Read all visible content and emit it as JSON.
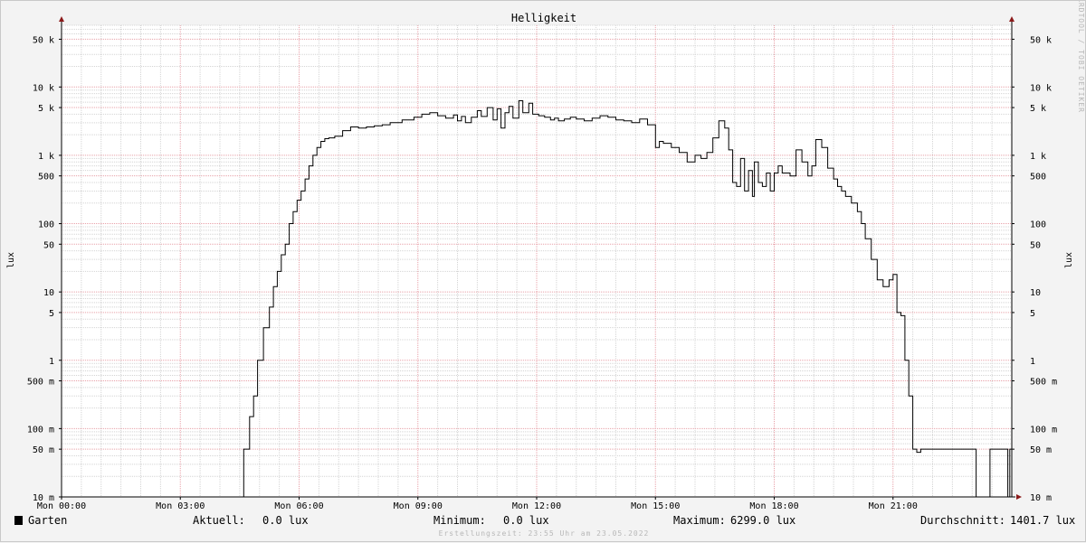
{
  "chart_data": {
    "type": "line",
    "title": "Helligkeit",
    "ylabel": "lux",
    "ylabel_right": "lux",
    "yscale": "log",
    "ylim": [
      0.01,
      80000
    ],
    "xlim": [
      0,
      24
    ],
    "watermark": "RRDTOOL / TOBI OETIKER",
    "grid": true,
    "x_ticks": [
      {
        "value": 0,
        "label": "Mon 00:00"
      },
      {
        "value": 3,
        "label": "Mon 03:00"
      },
      {
        "value": 6,
        "label": "Mon 06:00"
      },
      {
        "value": 9,
        "label": "Mon 09:00"
      },
      {
        "value": 12,
        "label": "Mon 12:00"
      },
      {
        "value": 15,
        "label": "Mon 15:00"
      },
      {
        "value": 18,
        "label": "Mon 18:00"
      },
      {
        "value": 21,
        "label": "Mon 21:00"
      }
    ],
    "y_ticks": [
      {
        "value": 0.01,
        "label": "10 m"
      },
      {
        "value": 0.05,
        "label": "50 m"
      },
      {
        "value": 0.1,
        "label": "100 m"
      },
      {
        "value": 0.5,
        "label": "500 m"
      },
      {
        "value": 1,
        "label": "1"
      },
      {
        "value": 5,
        "label": "5"
      },
      {
        "value": 10,
        "label": "10"
      },
      {
        "value": 50,
        "label": "50"
      },
      {
        "value": 100,
        "label": "100"
      },
      {
        "value": 500,
        "label": "500"
      },
      {
        "value": 1000,
        "label": "1 k"
      },
      {
        "value": 5000,
        "label": "5 k"
      },
      {
        "value": 10000,
        "label": "10 k"
      },
      {
        "value": 50000,
        "label": "50 k"
      }
    ],
    "series": [
      {
        "name": "Garten",
        "color": "#000000",
        "x": [
          0,
          4.6,
          4.6,
          4.75,
          4.85,
          4.95,
          5.1,
          5.25,
          5.35,
          5.45,
          5.55,
          5.65,
          5.75,
          5.85,
          5.95,
          6.05,
          6.15,
          6.25,
          6.35,
          6.45,
          6.55,
          6.65,
          6.75,
          6.9,
          7.1,
          7.3,
          7.5,
          7.7,
          7.9,
          8.1,
          8.3,
          8.6,
          8.9,
          9.1,
          9.3,
          9.5,
          9.7,
          9.9,
          10.0,
          10.1,
          10.2,
          10.35,
          10.5,
          10.6,
          10.75,
          10.9,
          11.0,
          11.1,
          11.2,
          11.3,
          11.4,
          11.55,
          11.65,
          11.8,
          11.9,
          12.05,
          12.2,
          12.35,
          12.45,
          12.55,
          12.7,
          12.85,
          13.0,
          13.2,
          13.4,
          13.6,
          13.8,
          14.0,
          14.2,
          14.4,
          14.6,
          14.8,
          15.0,
          15.1,
          15.2,
          15.4,
          15.6,
          15.8,
          16.0,
          16.15,
          16.3,
          16.45,
          16.6,
          16.75,
          16.85,
          16.95,
          17.05,
          17.15,
          17.25,
          17.35,
          17.45,
          17.5,
          17.6,
          17.7,
          17.8,
          17.9,
          18.0,
          18.1,
          18.2,
          18.3,
          18.4,
          18.55,
          18.7,
          18.85,
          18.95,
          19.05,
          19.2,
          19.35,
          19.5,
          19.6,
          19.7,
          19.8,
          19.95,
          20.1,
          20.2,
          20.3,
          20.45,
          20.6,
          20.75,
          20.9,
          21.0,
          21.1,
          21.2,
          21.3,
          21.4,
          21.5,
          21.6,
          21.7,
          21.8,
          21.9,
          22.0,
          22.1,
          22.2,
          22.3,
          22.5,
          22.8,
          23.1,
          23.4,
          23.45,
          23.85,
          23.9,
          23.95,
          24.0
        ],
        "y": [
          0.01,
          0.01,
          0.05,
          0.15,
          0.3,
          1.0,
          3.0,
          6.0,
          12,
          20,
          35,
          50,
          100,
          150,
          220,
          300,
          450,
          700,
          1000,
          1300,
          1600,
          1750,
          1800,
          1900,
          2300,
          2600,
          2500,
          2600,
          2700,
          2800,
          3000,
          3300,
          3600,
          4000,
          4200,
          3800,
          3500,
          3900,
          3200,
          3700,
          3000,
          3600,
          4500,
          3700,
          5000,
          3300,
          4800,
          2500,
          4200,
          5200,
          3500,
          6299,
          4200,
          5800,
          4000,
          3800,
          3600,
          3300,
          3500,
          3200,
          3400,
          3600,
          3400,
          3200,
          3500,
          3800,
          3600,
          3300,
          3200,
          3000,
          3400,
          2800,
          1300,
          1600,
          1500,
          1300,
          1100,
          800,
          1000,
          900,
          1100,
          1800,
          3200,
          2500,
          1200,
          400,
          350,
          900,
          300,
          600,
          250,
          800,
          400,
          350,
          550,
          300,
          550,
          700,
          550,
          550,
          500,
          1200,
          800,
          500,
          700,
          1700,
          1300,
          650,
          450,
          350,
          300,
          250,
          200,
          150,
          100,
          60,
          30,
          15,
          12,
          15,
          18,
          5,
          4.5,
          1.0,
          0.3,
          0.05,
          0.045,
          0.05,
          0.05,
          0.05,
          0.05,
          0.05,
          0.05,
          0.05,
          0.05,
          0.05,
          0.01,
          0.01,
          0.05,
          0.05,
          0.01,
          0.05,
          0.05
        ]
      }
    ],
    "legend": {
      "name": "Garten",
      "current_label": "Aktuell:",
      "current_value": "0.0 lux",
      "min_label": "Minimum:",
      "min_value": "0.0 lux",
      "max_label": "Maximum:",
      "max_value": "6299.0 lux",
      "avg_label": "Durchschnitt:",
      "avg_value": "1401.7 lux"
    },
    "footer": "Erstellungszeit: 23:55 Uhr am 23.05.2022"
  },
  "colors": {
    "background": "#f3f3f3",
    "plot": "#ffffff",
    "major_grid": "#e8a0a8",
    "minor_grid": "#d4d4d4",
    "axis_arrow": "#8b1a1a",
    "line": "#000000"
  }
}
